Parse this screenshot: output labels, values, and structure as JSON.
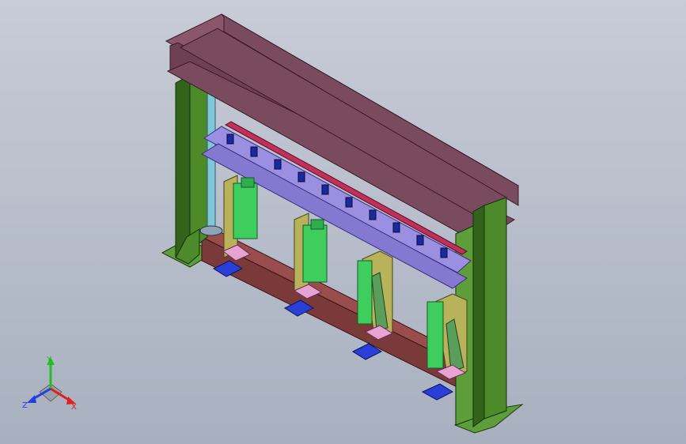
{
  "viewport": {
    "background_top": "#c7ccd6",
    "background_bottom": "#a8b0bf"
  },
  "model": {
    "colors": {
      "beam": "#7a4b5e",
      "beam_dark": "#5a3345",
      "column": "#4d8a2a",
      "column_dark": "#33631a",
      "base_beam": "#7a3a3a",
      "clamp_green": "#3fce5e",
      "bracket_tan": "#b8b25a",
      "purple_rail": "#9a8fe0",
      "blue_pad": "#2a3ed8",
      "pink_pad": "#e7a3d2",
      "cyan_rod": "#7fc7d6",
      "foot_plate": "#5e9e3a"
    }
  },
  "triad": {
    "x_label": "X",
    "y_label": "Y",
    "z_label": "Z",
    "x_color": "#e02020",
    "y_color": "#20c020",
    "z_color": "#2040e0"
  }
}
